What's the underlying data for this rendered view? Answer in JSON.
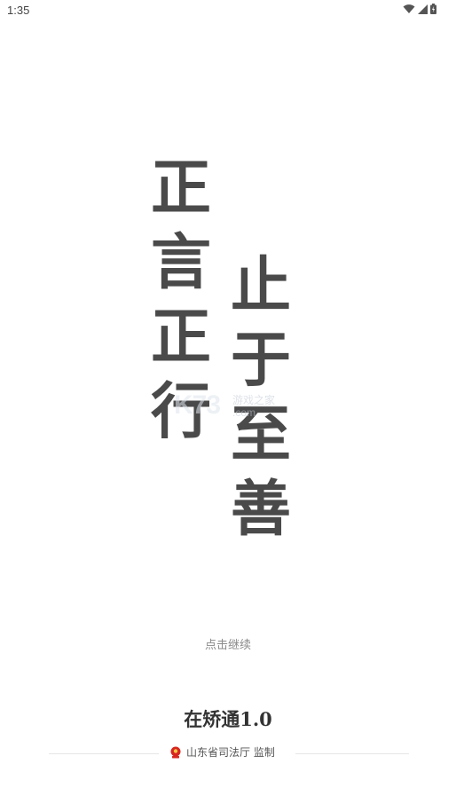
{
  "status_bar": {
    "time": "1:35",
    "icons": [
      "wifi-icon",
      "cell-signal-icon",
      "battery-icon"
    ]
  },
  "slogan": {
    "left_column": [
      "正",
      "言",
      "正",
      "行"
    ],
    "right_column": [
      "止",
      "于",
      "至",
      "善"
    ]
  },
  "watermark": {
    "brand": "K73",
    "name": "游戏之家",
    "domain": ".com"
  },
  "tap_continue": "点击继续",
  "app_name": "在矫通1.0",
  "supervisor": {
    "text": "山东省司法厅 监制",
    "emblem_icon": "national-emblem-icon",
    "emblem_color": "#d7261e"
  },
  "colors": {
    "slogan": "#4a4a4a",
    "background": "#ffffff",
    "hint": "#8a8a8a"
  }
}
